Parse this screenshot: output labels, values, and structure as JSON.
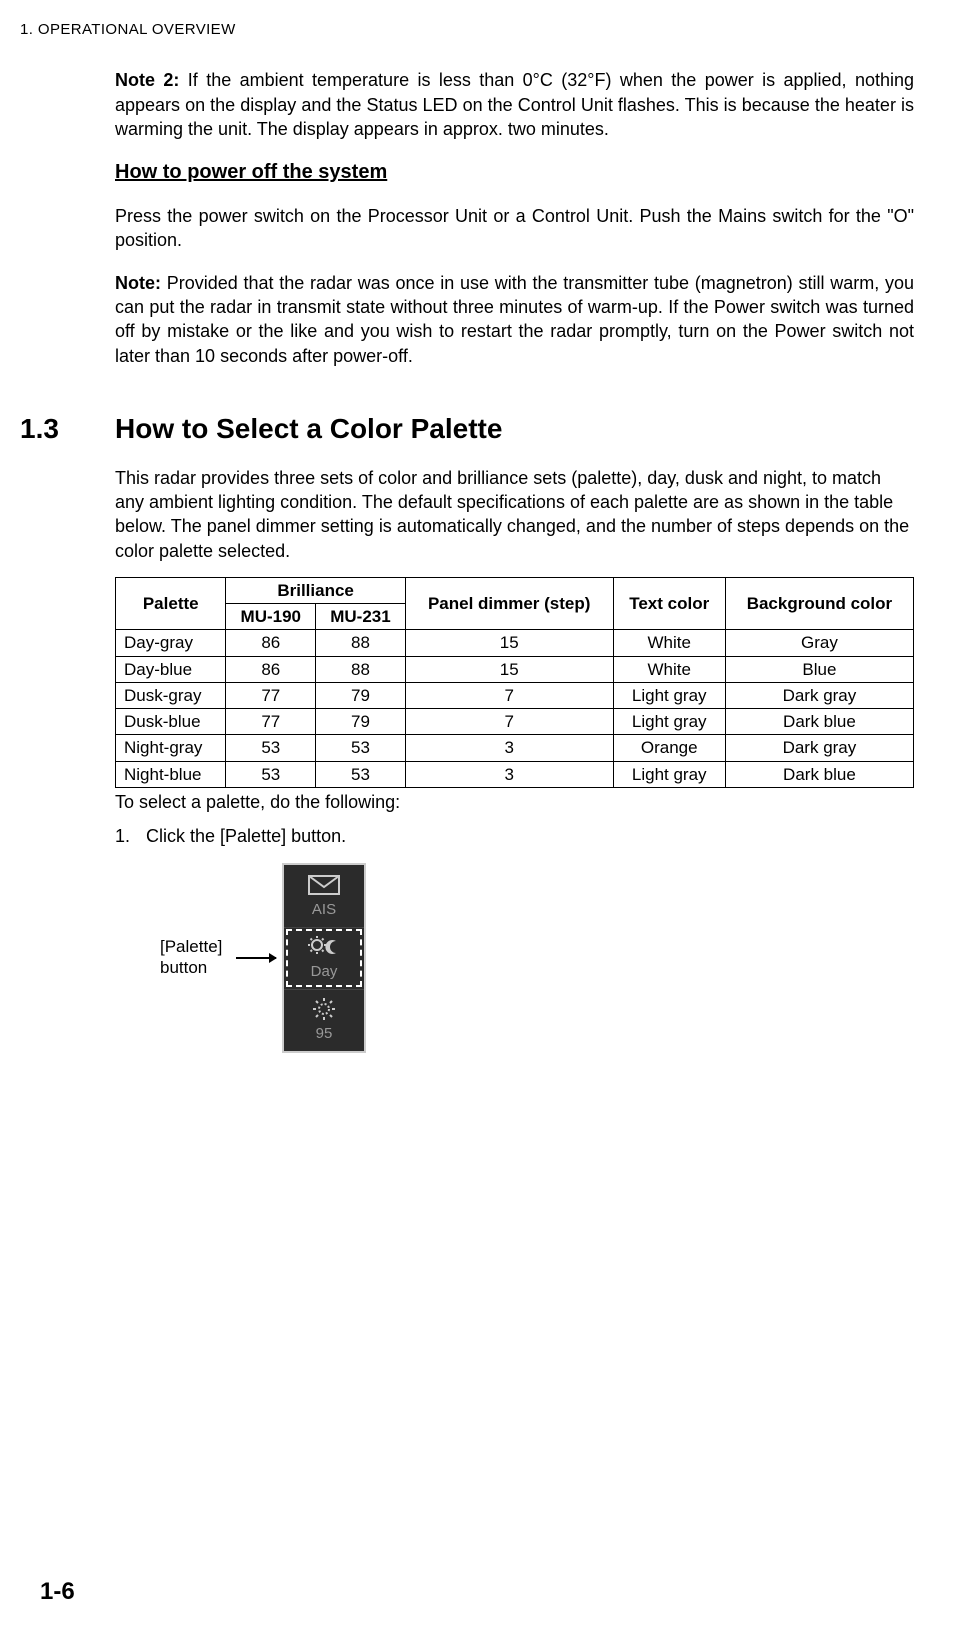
{
  "header": "1.  OPERATIONAL OVERVIEW",
  "note2_label": "Note 2:",
  "note2_text": " If the ambient temperature is less than 0°C (32°F) when the power is applied, nothing appears on the display and the Status LED on the Control Unit flashes. This is because the heater is warming the unit. The display appears in approx. two minutes.",
  "poweroff_heading": "How to power off the system",
  "poweroff_para": "Press the power switch on the Processor Unit or a Control Unit. Push the Mains switch for the \"O\" position.",
  "note_label": "Note:",
  "note_text": " Provided that the radar was once in use with the transmitter tube (magnetron) still warm, you can put the radar in transmit state without three minutes of warm-up. If the Power switch was turned off by mistake or the like and you wish to restart the radar promptly, turn on the Power switch not later than 10 seconds after power-off.",
  "section_num": "1.3",
  "section_title": "How to Select a Color Palette",
  "section_intro": "This radar provides three sets of color and brilliance sets (palette), day, dusk and night, to match any ambient lighting condition. The default specifications of each palette are as shown in the table below. The panel dimmer setting is automatically changed, and the number of steps depends on the color palette selected.",
  "table": {
    "headers": {
      "palette": "Palette",
      "brilliance": "Brilliance",
      "mu190": "MU-190",
      "mu231": "MU-231",
      "dimmer": "Panel dimmer (step)",
      "text": "Text color",
      "bg": "Background color"
    },
    "rows": [
      {
        "palette": "Day-gray",
        "mu190": "86",
        "mu231": "88",
        "dimmer": "15",
        "text": "White",
        "bg": "Gray"
      },
      {
        "palette": "Day-blue",
        "mu190": "86",
        "mu231": "88",
        "dimmer": "15",
        "text": "White",
        "bg": "Blue"
      },
      {
        "palette": "Dusk-gray",
        "mu190": "77",
        "mu231": "79",
        "dimmer": "7",
        "text": "Light gray",
        "bg": "Dark gray"
      },
      {
        "palette": "Dusk-blue",
        "mu190": "77",
        "mu231": "79",
        "dimmer": "7",
        "text": "Light gray",
        "bg": "Dark blue"
      },
      {
        "palette": "Night-gray",
        "mu190": "53",
        "mu231": "53",
        "dimmer": "3",
        "text": "Orange",
        "bg": "Dark gray"
      },
      {
        "palette": "Night-blue",
        "mu190": "53",
        "mu231": "53",
        "dimmer": "3",
        "text": "Light gray",
        "bg": "Dark blue"
      }
    ]
  },
  "post_table": "To select a palette, do the following:",
  "step1_num": "1.",
  "step1_text": "Click the [Palette] button.",
  "fig_label_l1": "[Palette]",
  "fig_label_l2": "button",
  "ui": {
    "ais": "AIS",
    "day": "Day",
    "num": "95"
  },
  "page_number": "1-6"
}
